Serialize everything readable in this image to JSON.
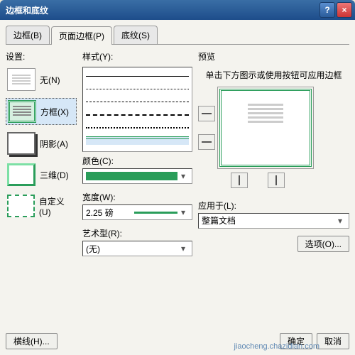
{
  "title": "边框和底纹",
  "tabs": {
    "t1": "边框(B)",
    "t2": "页面边框(P)",
    "t3": "底纹(S)"
  },
  "settings": {
    "label": "设置:",
    "none": "无(N)",
    "box": "方框(X)",
    "shadow": "阴影(A)",
    "three_d": "三维(D)",
    "custom": "自定义(U)"
  },
  "style": {
    "label": "样式(Y):",
    "color_label": "颜色(C):",
    "width_label": "宽度(W):",
    "width_value": "2.25 磅",
    "art_label": "艺术型(R):",
    "art_value": "(无)"
  },
  "preview": {
    "label": "预览",
    "hint": "单击下方图示或使用按钮可应用边框",
    "apply_label": "应用于(L):",
    "apply_value": "整篇文档",
    "options": "选项(O)..."
  },
  "footer": {
    "hline": "横线(H)...",
    "ok": "确定",
    "cancel": "取消"
  },
  "watermark": "jiaocheng.chazidian.com"
}
